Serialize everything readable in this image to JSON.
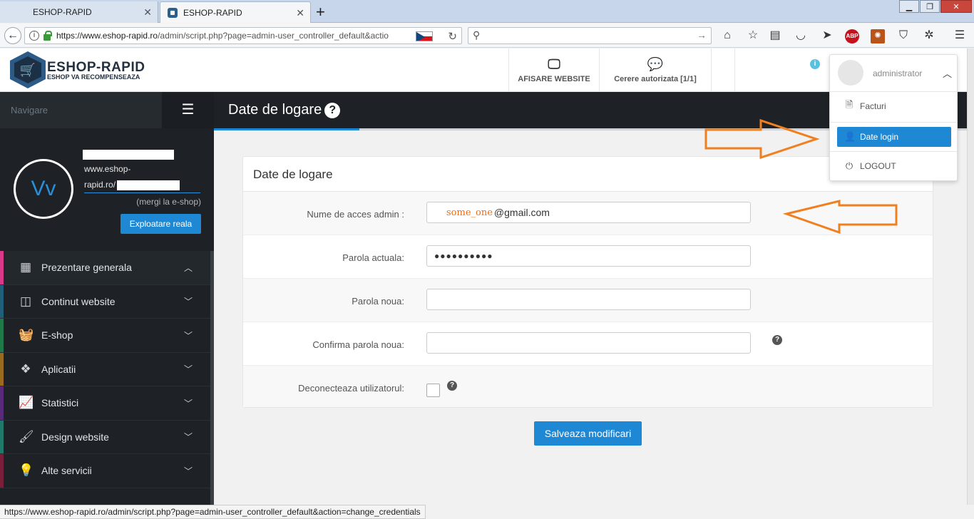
{
  "browser": {
    "tabs": [
      {
        "label": "ESHOP-RAPID",
        "active": false
      },
      {
        "label": "ESHOP-RAPID",
        "active": true
      }
    ],
    "url_host": "https://www.eshop-rapid.ro",
    "url_path": "/admin/script.php?page=admin-user_controller_default&actio",
    "search_placeholder": ""
  },
  "header": {
    "logo_title": "ESHOP-RAPID",
    "logo_subtitle": "ESHOP VA RECOMPENSEAZA",
    "nav": [
      {
        "label": "AFISARE WEBSITE",
        "icon": "monitor-icon"
      },
      {
        "label": "Cerere autorizata [1/1]",
        "icon": "comments-icon"
      }
    ]
  },
  "user_menu": {
    "username": "administrator",
    "items": [
      {
        "label": "Facturi",
        "icon": "invoice-icon",
        "active": false
      },
      {
        "label": "Date login",
        "icon": "user-icon",
        "active": true
      },
      {
        "label": "LOGOUT",
        "icon": "power-icon",
        "active": false
      }
    ]
  },
  "sidebar": {
    "nav_title": "Navigare",
    "avatar_initials": "Vv",
    "site_url_line1": "www.eshop-",
    "site_url_line2": "rapid.ro/",
    "site_link": "(mergi la e-shop)",
    "explore_button": "Exploatare reala",
    "items": [
      {
        "label": "Prezentare generala",
        "icon": "grid-icon",
        "accent": "#d83a8a",
        "expanded": true
      },
      {
        "label": "Continut website",
        "icon": "columns-icon",
        "accent": "#1f5f7a"
      },
      {
        "label": "E-shop",
        "icon": "basket-icon",
        "accent": "#1f7a4a"
      },
      {
        "label": "Aplicatii",
        "icon": "cubes-icon",
        "accent": "#9a6a1e"
      },
      {
        "label": "Statistici",
        "icon": "line-chart-icon",
        "accent": "#5a2a7a"
      },
      {
        "label": "Design website",
        "icon": "brush-icon",
        "accent": "#1f7a6a"
      },
      {
        "label": "Alte servicii",
        "icon": "bulb-icon",
        "accent": "#7a1e3a"
      }
    ]
  },
  "page": {
    "title": "Date de logare",
    "panel_title": "Date de logare",
    "form": {
      "login_label": "Nume de acces admin :",
      "login_handwritten": "some_one",
      "login_value": "@gmail.com",
      "current_password_label": "Parola actuala:",
      "current_password_mask": "●●●●●●●●●●",
      "new_password_label": "Parola noua:",
      "confirm_password_label": "Confirma parola noua:",
      "disconnect_label": "Deconecteaza utilizatorul:"
    },
    "save_button": "Salveaza modificari"
  },
  "status_url": "https://www.eshop-rapid.ro/admin/script.php?page=admin-user_controller_default&action=change_credentials",
  "colors": {
    "primary": "#1e88d5",
    "sidebar_bg": "#1e2226",
    "annotation_arrow": "#f0801f"
  }
}
